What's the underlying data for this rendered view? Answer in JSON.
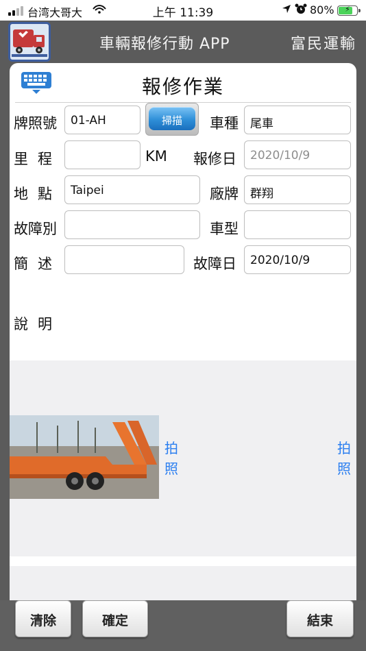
{
  "status_bar": {
    "carrier": "台湾大哥大",
    "time": "上午 11:39",
    "battery_percent": "80%",
    "battery_level": 0.8,
    "icons": [
      "signal-icon",
      "wifi-icon",
      "location-arrow-icon",
      "alarm-icon",
      "battery-charging-icon"
    ]
  },
  "app_header": {
    "title": "車輛報修行動 APP",
    "company": "富民運輸",
    "logo_icon": "truck-wrench-logo-icon"
  },
  "form": {
    "title": "報修作業",
    "keyboard_icon": "keyboard-icon",
    "plate": {
      "label": "牌照號",
      "value": "01-AH"
    },
    "scan_button": {
      "label": "掃描",
      "color": "#2f8fd8"
    },
    "vehicle_type": {
      "label": "車種",
      "value": "尾車"
    },
    "mileage": {
      "label": "里程",
      "value": "",
      "unit": "KM"
    },
    "report_date": {
      "label": "報修日",
      "value": "2020/10/9"
    },
    "location": {
      "label": "地點",
      "value": "Taipei"
    },
    "brand": {
      "label": "廠牌",
      "value": "群翔"
    },
    "fault_category": {
      "label": "故障別",
      "value": ""
    },
    "model": {
      "label": "車型",
      "value": ""
    },
    "summary": {
      "label": "簡述",
      "value": ""
    },
    "fault_date": {
      "label": "故障日",
      "value": "2020/10/9"
    },
    "description": {
      "label": "說明"
    }
  },
  "photos": {
    "take_photo_label": "拍照",
    "link_color": "#2a7ef0"
  },
  "footer": {
    "clear_label": "清除",
    "confirm_label": "確定",
    "end_label": "結束"
  }
}
